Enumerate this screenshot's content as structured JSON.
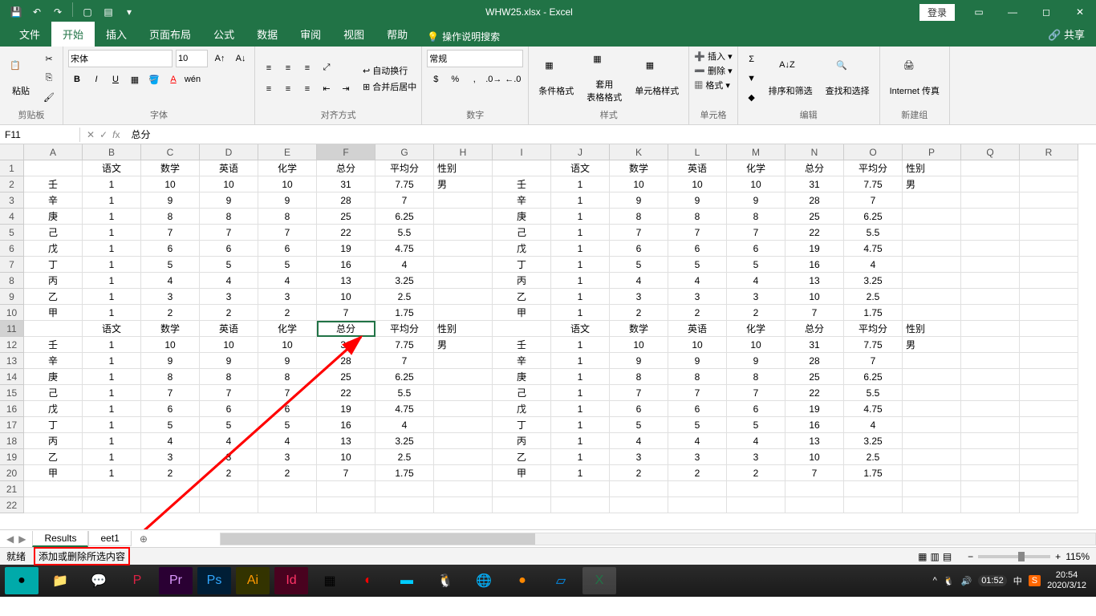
{
  "titlebar": {
    "filename": "WHW25.xlsx  -  Excel",
    "login": "登录"
  },
  "tabs": {
    "file": "文件",
    "home": "开始",
    "insert": "插入",
    "layout": "页面布局",
    "formulas": "公式",
    "data": "数据",
    "review": "审阅",
    "view": "视图",
    "help": "帮助",
    "tellme": "操作说明搜索",
    "share": "共享"
  },
  "ribbon": {
    "clipboard": {
      "paste": "粘贴",
      "label": "剪贴板"
    },
    "font": {
      "name": "宋体",
      "size": "10",
      "label": "字体"
    },
    "align": {
      "wrap": "自动换行",
      "merge": "合并后居中",
      "label": "对齐方式"
    },
    "number": {
      "format": "常规",
      "label": "数字"
    },
    "styles": {
      "cond": "条件格式",
      "table": "套用\n表格格式",
      "cell": "单元格样式",
      "label": "样式"
    },
    "cells": {
      "insert": "插入",
      "delete": "删除",
      "format": "格式",
      "label": "单元格"
    },
    "editing": {
      "sort": "排序和筛选",
      "find": "查找和选择",
      "label": "编辑"
    },
    "new": {
      "fax": "Internet 传真",
      "label": "新建组"
    }
  },
  "formula": {
    "ref": "F11",
    "value": "总分"
  },
  "columns": [
    "A",
    "B",
    "C",
    "D",
    "E",
    "F",
    "G",
    "H",
    "I",
    "J",
    "K",
    "L",
    "M",
    "N",
    "O",
    "P",
    "Q",
    "R"
  ],
  "headers": [
    "",
    "语文",
    "数学",
    "英语",
    "化学",
    "总分",
    "平均分",
    "性别"
  ],
  "rows": [
    [
      "壬",
      "1",
      "10",
      "10",
      "10",
      "31",
      "7.75",
      "男"
    ],
    [
      "辛",
      "1",
      "9",
      "9",
      "9",
      "28",
      "7",
      ""
    ],
    [
      "庚",
      "1",
      "8",
      "8",
      "8",
      "25",
      "6.25",
      ""
    ],
    [
      "己",
      "1",
      "7",
      "7",
      "7",
      "22",
      "5.5",
      ""
    ],
    [
      "戊",
      "1",
      "6",
      "6",
      "6",
      "19",
      "4.75",
      ""
    ],
    [
      "丁",
      "1",
      "5",
      "5",
      "5",
      "16",
      "4",
      ""
    ],
    [
      "丙",
      "1",
      "4",
      "4",
      "4",
      "13",
      "3.25",
      ""
    ],
    [
      "乙",
      "1",
      "3",
      "3",
      "3",
      "10",
      "2.5",
      ""
    ],
    [
      "甲",
      "1",
      "2",
      "2",
      "2",
      "7",
      "1.75",
      ""
    ]
  ],
  "sheets": {
    "s1": "Results",
    "s2": "eet1"
  },
  "status": {
    "ready": "就绪",
    "tip": "添加或删除所选内容",
    "zoom": "115%"
  },
  "taskbar": {
    "time": "20:54",
    "date": "2020/3/12",
    "rec": "01:52",
    "ime": "中"
  }
}
